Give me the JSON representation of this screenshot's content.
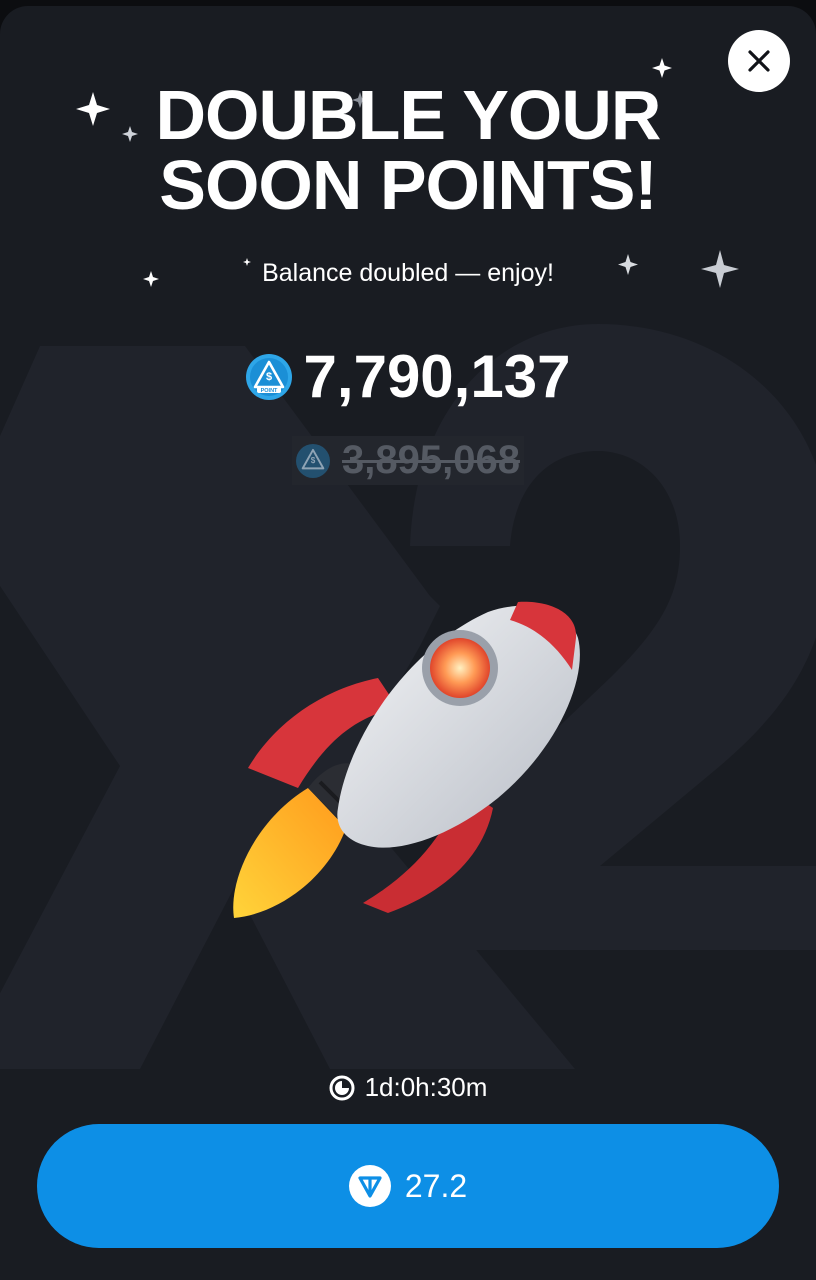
{
  "modal": {
    "title_line1": "DOUBLE YOUR",
    "title_line2": "SOON POINTS!",
    "subtitle": "Balance doubled — enjoy!",
    "new_balance": "7,790,137",
    "old_balance": "3,895,068",
    "timer": "1d:0h:30m",
    "price": "27.2",
    "background_text": "x2",
    "icons": {
      "close": "close-icon",
      "points": "points-coin-icon",
      "timer": "clock-icon",
      "currency": "ton-icon",
      "hero": "rocket-icon"
    }
  },
  "colors": {
    "background": "#191c22",
    "button": "#0d8fe6",
    "text": "#ffffff",
    "muted": "#555a63"
  }
}
